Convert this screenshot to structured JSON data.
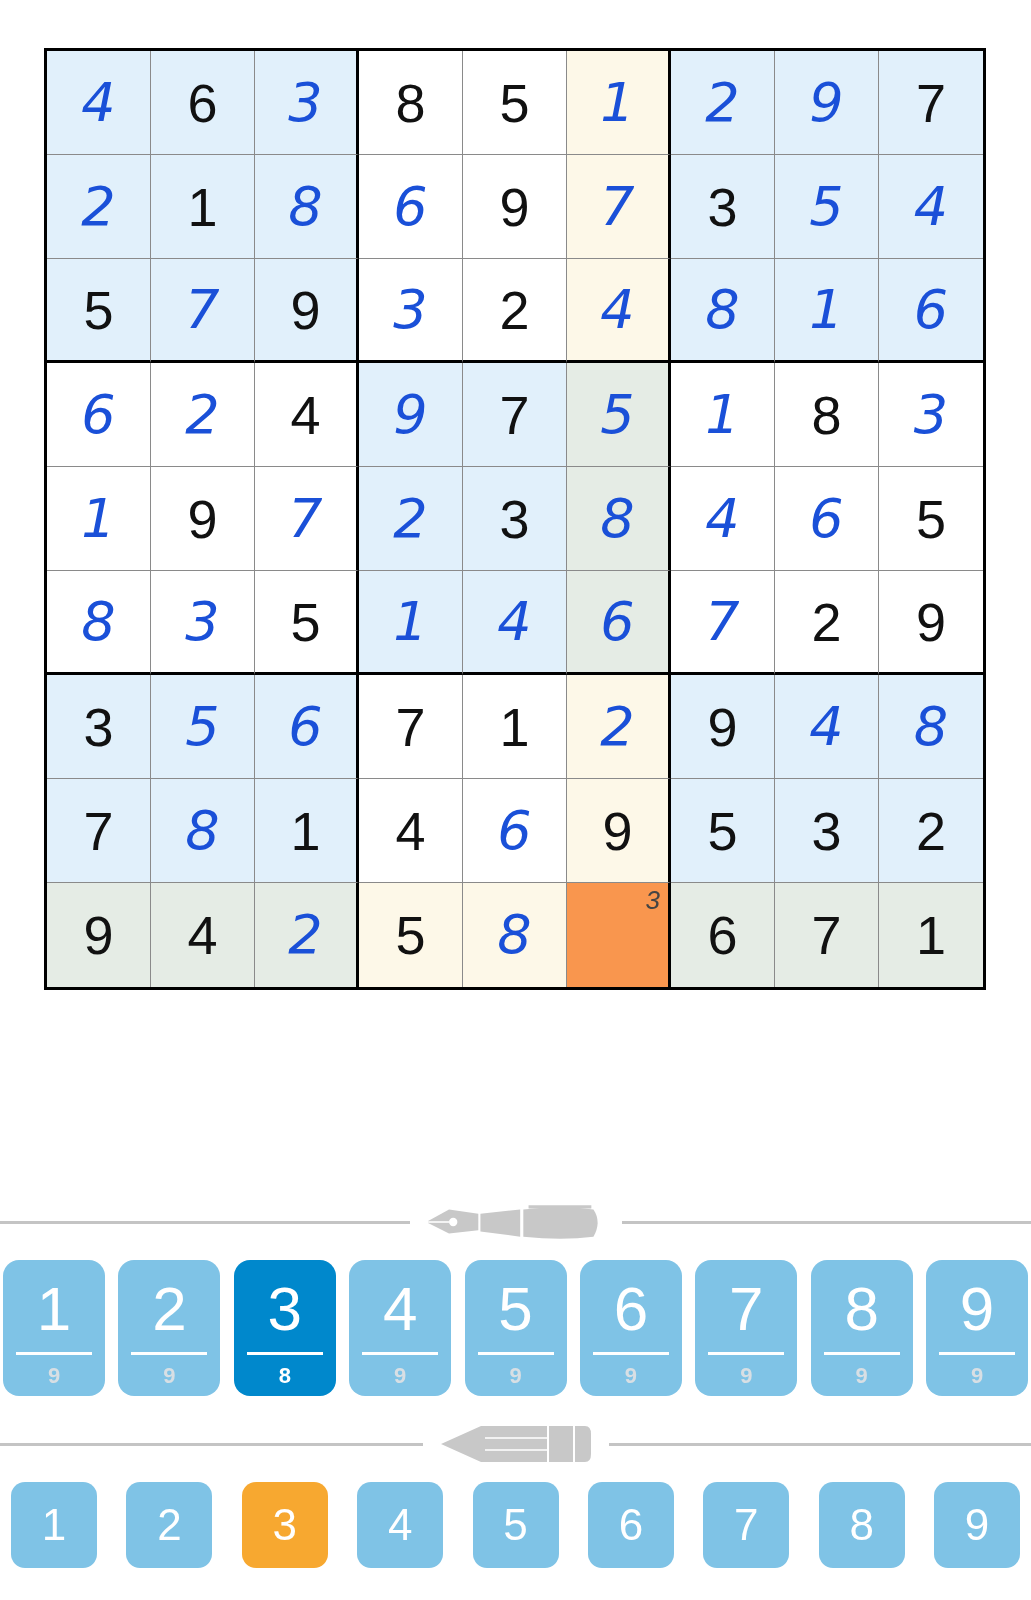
{
  "board": {
    "rows": [
      [
        {
          "value": "4",
          "kind": "entered",
          "highlighted": false,
          "selected": false
        },
        {
          "value": "6",
          "kind": "given",
          "highlighted": false,
          "selected": false
        },
        {
          "value": "3",
          "kind": "entered",
          "highlighted": false,
          "selected": false
        },
        {
          "value": "8",
          "kind": "given",
          "highlighted": false,
          "selected": false
        },
        {
          "value": "5",
          "kind": "given",
          "highlighted": false,
          "selected": false
        },
        {
          "value": "1",
          "kind": "entered",
          "highlighted": true,
          "selected": false
        },
        {
          "value": "2",
          "kind": "entered",
          "highlighted": false,
          "selected": false
        },
        {
          "value": "9",
          "kind": "entered",
          "highlighted": false,
          "selected": false
        },
        {
          "value": "7",
          "kind": "given",
          "highlighted": false,
          "selected": false
        }
      ],
      [
        {
          "value": "2",
          "kind": "entered",
          "highlighted": false,
          "selected": false
        },
        {
          "value": "1",
          "kind": "given",
          "highlighted": false,
          "selected": false
        },
        {
          "value": "8",
          "kind": "entered",
          "highlighted": false,
          "selected": false
        },
        {
          "value": "6",
          "kind": "entered",
          "highlighted": false,
          "selected": false
        },
        {
          "value": "9",
          "kind": "given",
          "highlighted": false,
          "selected": false
        },
        {
          "value": "7",
          "kind": "entered",
          "highlighted": true,
          "selected": false
        },
        {
          "value": "3",
          "kind": "given",
          "highlighted": false,
          "selected": false
        },
        {
          "value": "5",
          "kind": "entered",
          "highlighted": false,
          "selected": false
        },
        {
          "value": "4",
          "kind": "entered",
          "highlighted": false,
          "selected": false
        }
      ],
      [
        {
          "value": "5",
          "kind": "given",
          "highlighted": false,
          "selected": false
        },
        {
          "value": "7",
          "kind": "entered",
          "highlighted": false,
          "selected": false
        },
        {
          "value": "9",
          "kind": "given",
          "highlighted": false,
          "selected": false
        },
        {
          "value": "3",
          "kind": "entered",
          "highlighted": false,
          "selected": false
        },
        {
          "value": "2",
          "kind": "given",
          "highlighted": false,
          "selected": false
        },
        {
          "value": "4",
          "kind": "entered",
          "highlighted": true,
          "selected": false
        },
        {
          "value": "8",
          "kind": "entered",
          "highlighted": false,
          "selected": false
        },
        {
          "value": "1",
          "kind": "entered",
          "highlighted": false,
          "selected": false
        },
        {
          "value": "6",
          "kind": "entered",
          "highlighted": false,
          "selected": false
        }
      ],
      [
        {
          "value": "6",
          "kind": "entered",
          "highlighted": false,
          "selected": false
        },
        {
          "value": "2",
          "kind": "entered",
          "highlighted": false,
          "selected": false
        },
        {
          "value": "4",
          "kind": "given",
          "highlighted": false,
          "selected": false
        },
        {
          "value": "9",
          "kind": "entered",
          "highlighted": false,
          "selected": false
        },
        {
          "value": "7",
          "kind": "given",
          "highlighted": false,
          "selected": false
        },
        {
          "value": "5",
          "kind": "entered",
          "highlighted": true,
          "selected": false
        },
        {
          "value": "1",
          "kind": "entered",
          "highlighted": false,
          "selected": false
        },
        {
          "value": "8",
          "kind": "given",
          "highlighted": false,
          "selected": false
        },
        {
          "value": "3",
          "kind": "entered",
          "highlighted": false,
          "selected": false
        }
      ],
      [
        {
          "value": "1",
          "kind": "entered",
          "highlighted": false,
          "selected": false
        },
        {
          "value": "9",
          "kind": "given",
          "highlighted": false,
          "selected": false
        },
        {
          "value": "7",
          "kind": "entered",
          "highlighted": false,
          "selected": false
        },
        {
          "value": "2",
          "kind": "entered",
          "highlighted": false,
          "selected": false
        },
        {
          "value": "3",
          "kind": "given",
          "highlighted": false,
          "selected": false
        },
        {
          "value": "8",
          "kind": "entered",
          "highlighted": true,
          "selected": false
        },
        {
          "value": "4",
          "kind": "entered",
          "highlighted": false,
          "selected": false
        },
        {
          "value": "6",
          "kind": "entered",
          "highlighted": false,
          "selected": false
        },
        {
          "value": "5",
          "kind": "given",
          "highlighted": false,
          "selected": false
        }
      ],
      [
        {
          "value": "8",
          "kind": "entered",
          "highlighted": false,
          "selected": false
        },
        {
          "value": "3",
          "kind": "entered",
          "highlighted": false,
          "selected": false
        },
        {
          "value": "5",
          "kind": "given",
          "highlighted": false,
          "selected": false
        },
        {
          "value": "1",
          "kind": "entered",
          "highlighted": false,
          "selected": false
        },
        {
          "value": "4",
          "kind": "entered",
          "highlighted": false,
          "selected": false
        },
        {
          "value": "6",
          "kind": "entered",
          "highlighted": true,
          "selected": false
        },
        {
          "value": "7",
          "kind": "entered",
          "highlighted": false,
          "selected": false
        },
        {
          "value": "2",
          "kind": "given",
          "highlighted": false,
          "selected": false
        },
        {
          "value": "9",
          "kind": "given",
          "highlighted": false,
          "selected": false
        }
      ],
      [
        {
          "value": "3",
          "kind": "given",
          "highlighted": false,
          "selected": false
        },
        {
          "value": "5",
          "kind": "entered",
          "highlighted": false,
          "selected": false
        },
        {
          "value": "6",
          "kind": "entered",
          "highlighted": false,
          "selected": false
        },
        {
          "value": "7",
          "kind": "given",
          "highlighted": false,
          "selected": false
        },
        {
          "value": "1",
          "kind": "given",
          "highlighted": false,
          "selected": false
        },
        {
          "value": "2",
          "kind": "entered",
          "highlighted": true,
          "selected": false
        },
        {
          "value": "9",
          "kind": "given",
          "highlighted": false,
          "selected": false
        },
        {
          "value": "4",
          "kind": "entered",
          "highlighted": false,
          "selected": false
        },
        {
          "value": "8",
          "kind": "entered",
          "highlighted": false,
          "selected": false
        }
      ],
      [
        {
          "value": "7",
          "kind": "given",
          "highlighted": false,
          "selected": false
        },
        {
          "value": "8",
          "kind": "entered",
          "highlighted": false,
          "selected": false
        },
        {
          "value": "1",
          "kind": "given",
          "highlighted": false,
          "selected": false
        },
        {
          "value": "4",
          "kind": "given",
          "highlighted": false,
          "selected": false
        },
        {
          "value": "6",
          "kind": "entered",
          "highlighted": false,
          "selected": false
        },
        {
          "value": "9",
          "kind": "given",
          "highlighted": true,
          "selected": false
        },
        {
          "value": "5",
          "kind": "given",
          "highlighted": false,
          "selected": false
        },
        {
          "value": "3",
          "kind": "given",
          "highlighted": false,
          "selected": false
        },
        {
          "value": "2",
          "kind": "given",
          "highlighted": false,
          "selected": false
        }
      ],
      [
        {
          "value": "9",
          "kind": "given",
          "highlighted": true,
          "selected": false
        },
        {
          "value": "4",
          "kind": "given",
          "highlighted": true,
          "selected": false
        },
        {
          "value": "2",
          "kind": "entered",
          "highlighted": true,
          "selected": false
        },
        {
          "value": "5",
          "kind": "given",
          "highlighted": true,
          "selected": false
        },
        {
          "value": "8",
          "kind": "entered",
          "highlighted": true,
          "selected": false
        },
        {
          "notes": [
            "3"
          ],
          "selected": true
        },
        {
          "value": "6",
          "kind": "given",
          "highlighted": true,
          "selected": false
        },
        {
          "value": "7",
          "kind": "given",
          "highlighted": true,
          "selected": false
        },
        {
          "value": "1",
          "kind": "given",
          "highlighted": true,
          "selected": false
        }
      ]
    ]
  },
  "pen_pad": [
    {
      "digit": "1",
      "remaining": "9",
      "selected": false
    },
    {
      "digit": "2",
      "remaining": "9",
      "selected": false
    },
    {
      "digit": "3",
      "remaining": "8",
      "selected": true
    },
    {
      "digit": "4",
      "remaining": "9",
      "selected": false
    },
    {
      "digit": "5",
      "remaining": "9",
      "selected": false
    },
    {
      "digit": "6",
      "remaining": "9",
      "selected": false
    },
    {
      "digit": "7",
      "remaining": "9",
      "selected": false
    },
    {
      "digit": "8",
      "remaining": "9",
      "selected": false
    },
    {
      "digit": "9",
      "remaining": "9",
      "selected": false
    }
  ],
  "pencil_pad": [
    {
      "digit": "1",
      "selected": false
    },
    {
      "digit": "2",
      "selected": false
    },
    {
      "digit": "3",
      "selected": true
    },
    {
      "digit": "4",
      "selected": false
    },
    {
      "digit": "5",
      "selected": false
    },
    {
      "digit": "6",
      "selected": false
    },
    {
      "digit": "7",
      "selected": false
    },
    {
      "digit": "8",
      "selected": false
    },
    {
      "digit": "9",
      "selected": false
    }
  ]
}
